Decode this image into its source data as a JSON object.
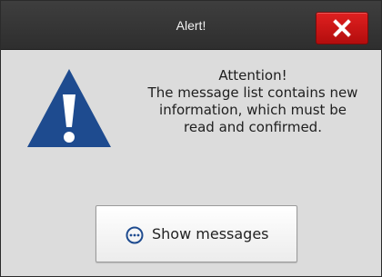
{
  "window": {
    "title": "Alert!"
  },
  "alert": {
    "heading": "Attention!",
    "lines": [
      "The message list contains new",
      "information, which must be",
      "read and confirmed."
    ]
  },
  "buttons": {
    "show_messages_label": "Show messages"
  },
  "icons": {
    "close": "close-icon",
    "warning": "warning-triangle-icon",
    "messages": "ellipsis-circle-icon"
  },
  "colors": {
    "titlebar": "#333333",
    "close_button": "#c81515",
    "warning_triangle": "#1e4b8f",
    "background": "#dcdcdc"
  }
}
